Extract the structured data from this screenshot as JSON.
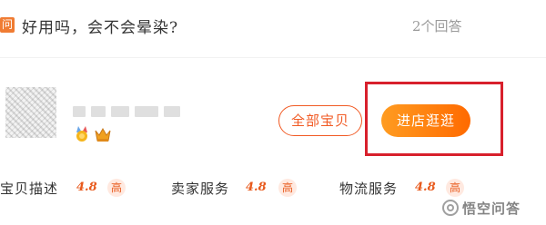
{
  "question": {
    "badge": "问",
    "text": "好用吗，会不会晕染?",
    "answer_count": "2个回答"
  },
  "shop": {
    "logo_icon": "shop-logo",
    "badges": [
      "medal-icon",
      "crown-icon"
    ],
    "buttons": {
      "all_items": "全部宝贝",
      "enter_shop": "进店逛逛"
    }
  },
  "ratings": [
    {
      "label": "宝贝描述",
      "score": "4.8",
      "level": "高"
    },
    {
      "label": "卖家服务",
      "score": "4.8",
      "level": "高"
    },
    {
      "label": "物流服务",
      "score": "4.8",
      "level": "高"
    }
  ],
  "watermark": {
    "text": "悟空问答"
  },
  "colors": {
    "accent": "#f15a24",
    "button_gradient_start": "#ff9c21",
    "button_gradient_end": "#ff6a00",
    "highlight_border": "#d8202c"
  }
}
